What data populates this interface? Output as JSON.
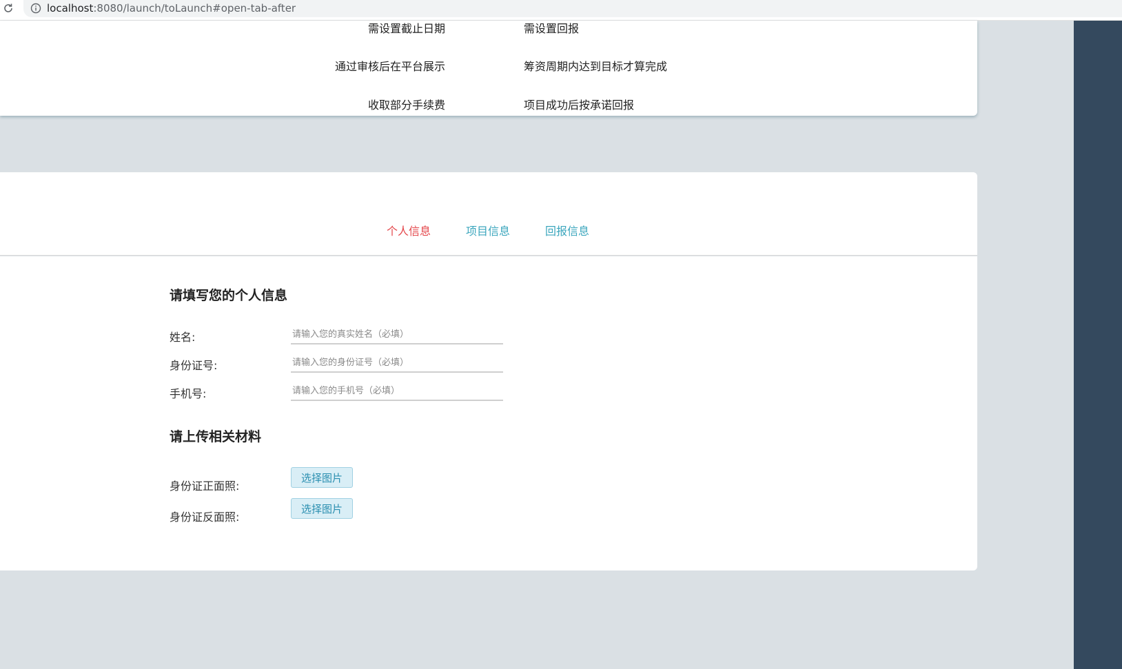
{
  "browser": {
    "url_host": "localhost",
    "url_rest": ":8080/launch/toLaunch#open-tab-after"
  },
  "compare": {
    "left": [
      "需设置截止日期",
      "通过审核后在平台展示",
      "收取部分手续费"
    ],
    "right": [
      "需设置回报",
      "筹资周期内达到目标才算完成",
      "项目成功后按承诺回报"
    ]
  },
  "tabs": [
    {
      "label": "个人信息",
      "active": true
    },
    {
      "label": "项目信息",
      "active": false
    },
    {
      "label": "回报信息",
      "active": false
    }
  ],
  "form": {
    "personal_title": "请填写您的个人信息",
    "name_label": "姓名:",
    "name_placeholder": "请输入您的真实姓名（必填）",
    "id_label": "身份证号:",
    "id_placeholder": "请输入您的身份证号（必填）",
    "phone_label": "手机号:",
    "phone_placeholder": "请输入您的手机号（必填）",
    "upload_title": "请上传相关材料",
    "id_front_label": "身份证正面照:",
    "id_back_label": "身份证反面照:",
    "choose_image_label": "选择图片"
  },
  "colors": {
    "tab_active": "#e4474b",
    "tab_inactive": "#3ba6bd",
    "sidebar": "#34495e",
    "page_bg": "#dae0e4"
  }
}
